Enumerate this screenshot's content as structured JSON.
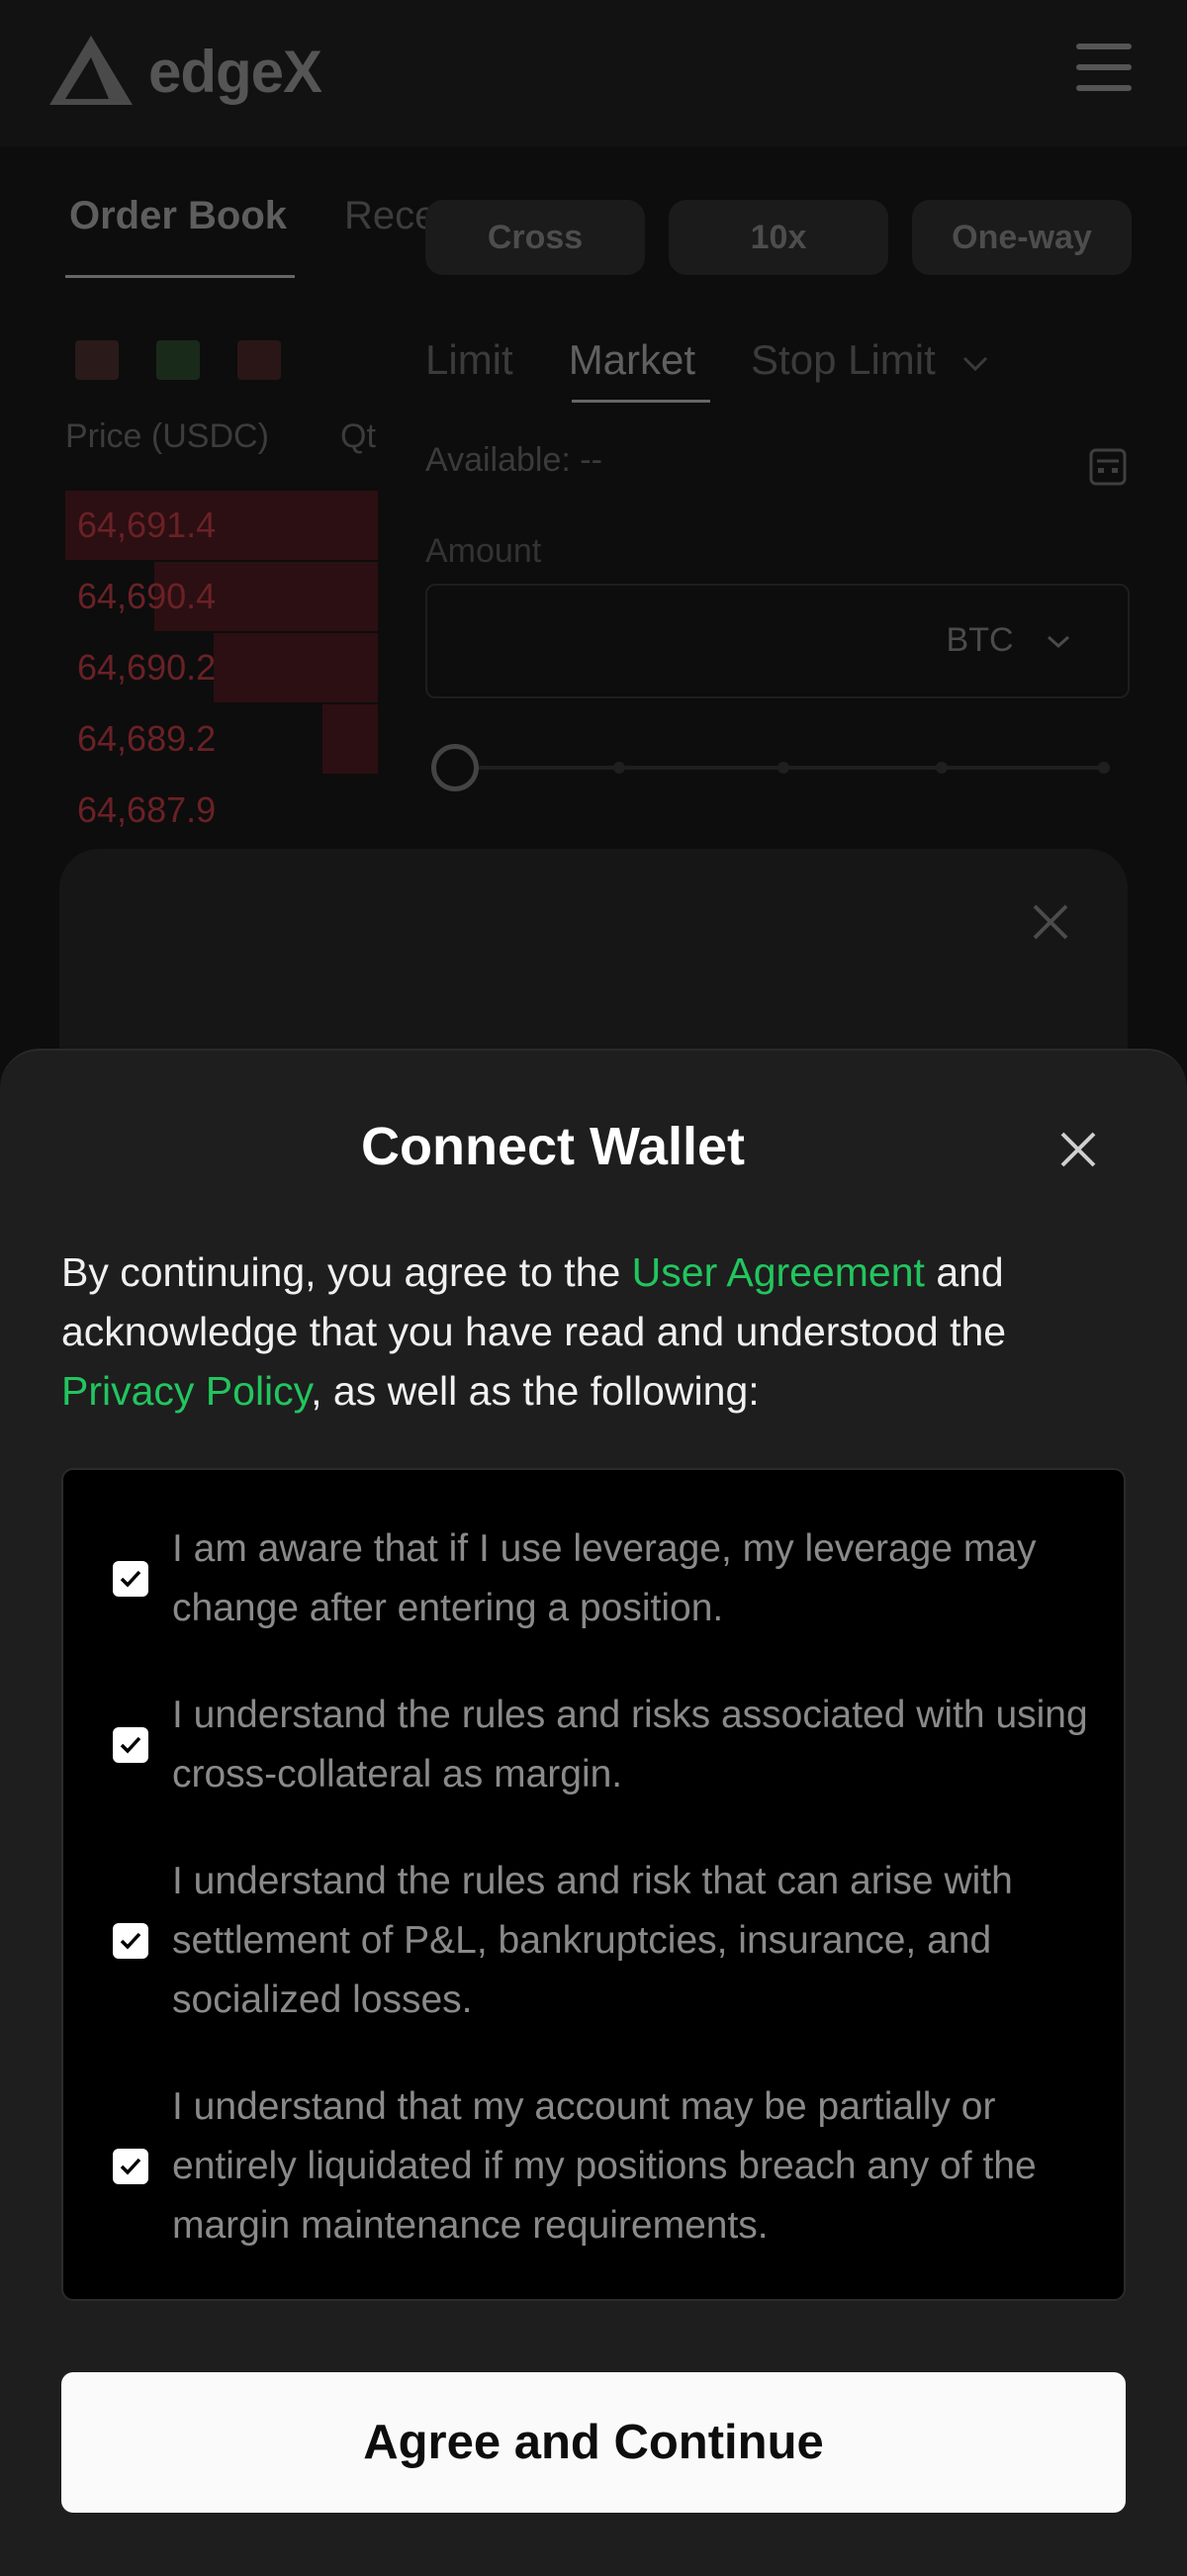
{
  "header": {
    "brand": "edgeX"
  },
  "orderbook": {
    "tabs": [
      "Order Book",
      "Recent Trades"
    ],
    "columns": [
      "Price (USDC)",
      "Qt"
    ],
    "asks": [
      "64,691.4",
      "64,690.4",
      "64,690.2",
      "64,689.2",
      "64,687.9"
    ]
  },
  "trade": {
    "pills": [
      "Cross",
      "10x",
      "One-way"
    ],
    "order_tabs": [
      "Limit",
      "Market",
      "Stop Limit"
    ],
    "available": "Available: --",
    "amount_label": "Amount",
    "amount_unit": "BTC"
  },
  "modal": {
    "title": "Connect Wallet",
    "intro": {
      "part1": "By continuing, you agree to the ",
      "link1": "User Agreement",
      "part2": " and acknowledge that you have read and understood the ",
      "link2": "Privacy Policy",
      "part3": ", as well as the following:"
    },
    "items": [
      "I am aware that if I use leverage, my leverage may change after entering a position.",
      "I understand the rules and risks associated with using cross-collateral as margin.",
      "I understand the rules and risk that can arise with settlement of P&L, bankruptcies, insurance, and socialized losses.",
      "I understand that my account may be partially or entirely liquidated if my positions breach any of the margin maintenance requirements."
    ],
    "agree_label": "Agree and Continue"
  },
  "colors": {
    "accent": "#22c55e",
    "sheet_bg": "#1e1e1e",
    "checklist_bg": "#000000",
    "ask_red": "#6a2126"
  }
}
